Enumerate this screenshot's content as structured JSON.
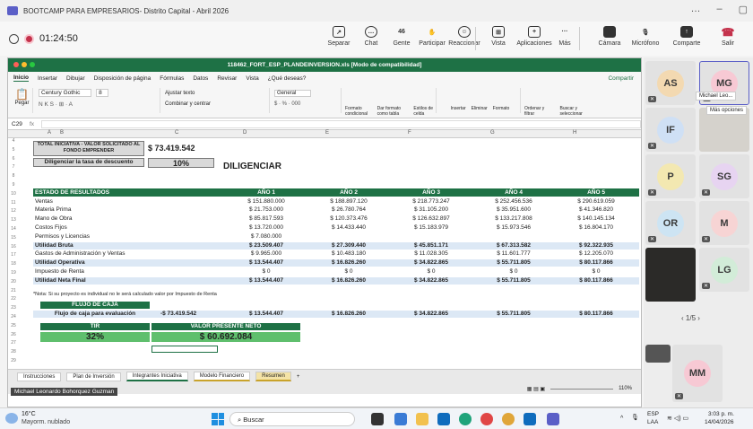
{
  "window": {
    "title": "BOOTCAMP PARA EMPRESARIOS- Distrito Capital - Abril 2026",
    "controls": [
      "…",
      "–",
      "▢"
    ]
  },
  "meeting": {
    "timer": "01:24:50",
    "buttons": {
      "separar": "Separar",
      "chat": "Chat",
      "gente": "Gente",
      "gente_count": "46",
      "participar": "Participar",
      "reaccionar": "Reaccionar",
      "vista": "Vista",
      "aplicaciones": "Aplicaciones",
      "mas": "Más",
      "camara": "Cámara",
      "microfono": "Micrófono",
      "comparte": "Comparte",
      "salir": "Salir"
    }
  },
  "excel": {
    "filename": "118462_FORT_ESP_PLANDEINVERSION.xls [Modo de compatibilidad]",
    "share": "Compartir",
    "menus": [
      "Inicio",
      "Insertar",
      "Dibujar",
      "Disposición de página",
      "Fórmulas",
      "Datos",
      "Revisar",
      "Vista",
      "¿Qué deseas?"
    ],
    "ribbon": {
      "paste": "Pegar",
      "font": "Century Gothic",
      "size": "8",
      "wrap": "Ajustar texto",
      "merge": "Combinar y centrar",
      "format": "General",
      "cond": "Formato condicional",
      "table": "Dar formato como tabla",
      "styles": "Estilos de celda",
      "insert": "Insertar",
      "delete": "Eliminar",
      "fmt": "Formato",
      "sort": "Ordenar y filtrar",
      "find": "Buscar y seleccionar"
    },
    "cellref": "C29",
    "fx": "fx",
    "columns": [
      "A",
      "B",
      "C",
      "D",
      "E",
      "F",
      "G",
      "H"
    ],
    "rows": [
      "4",
      "5",
      "6",
      "7",
      "8",
      "9",
      "10",
      "11",
      "12",
      "13",
      "14",
      "15",
      "16",
      "17",
      "18",
      "19",
      "20",
      "21",
      "22",
      "23",
      "24",
      "25",
      "26",
      "27",
      "28",
      "29"
    ],
    "total_label": "TOTAL INICIATIVA - VALOR SOLICITADO AL FONDO EMPRENDER",
    "total_value": "$ 73.419.542",
    "rate_label": "Diligenciar la tasa de descuento",
    "rate_value": "10%",
    "diligenciar": "DILIGENCIAR",
    "statement_header": [
      "ESTADO DE RESULTADOS",
      "AÑO 1",
      "AÑO 2",
      "AÑO 3",
      "AÑO 4",
      "AÑO 5"
    ],
    "statement": [
      {
        "label": "Ventas",
        "vals": [
          "$ 151.880.000",
          "$ 188.897.120",
          "$ 218.773.247",
          "$ 252.456.536",
          "$ 290.619.059"
        ],
        "bold": false
      },
      {
        "label": "Materia Prima",
        "vals": [
          "$ 21.753.000",
          "$ 26.780.764",
          "$ 31.105.200",
          "$ 35.951.600",
          "$ 41.346.820"
        ],
        "bold": false
      },
      {
        "label": "Mano de Obra",
        "vals": [
          "$ 85.817.593",
          "$ 120.373.476",
          "$ 126.632.897",
          "$ 133.217.808",
          "$ 140.145.134"
        ],
        "bold": false
      },
      {
        "label": "Costos Fijos",
        "vals": [
          "$ 13.720.000",
          "$ 14.433.440",
          "$ 15.183.979",
          "$ 15.973.546",
          "$ 16.804.170"
        ],
        "bold": false
      },
      {
        "label": "Permisos y Licencias",
        "vals": [
          "$ 7.080.000",
          "",
          "",
          "",
          ""
        ],
        "bold": false
      },
      {
        "label": "Utilidad Bruta",
        "vals": [
          "$ 23.509.407",
          "$ 27.309.440",
          "$ 45.851.171",
          "$ 67.313.582",
          "$ 92.322.935"
        ],
        "bold": true
      },
      {
        "label": "Gastos de Administración y Ventas",
        "vals": [
          "$ 9.965.000",
          "$ 10.483.180",
          "$ 11.028.305",
          "$ 11.601.777",
          "$ 12.205.070"
        ],
        "bold": false
      },
      {
        "label": "Utilidad Operativa",
        "vals": [
          "$ 13.544.407",
          "$ 16.826.260",
          "$ 34.822.865",
          "$ 55.711.805",
          "$ 80.117.866"
        ],
        "bold": true
      },
      {
        "label": "Impuesto de Renta",
        "vals": [
          "$ 0",
          "$ 0",
          "$ 0",
          "$ 0",
          "$ 0"
        ],
        "bold": false
      },
      {
        "label": "Utilidad Neta Final",
        "vals": [
          "$ 13.544.407",
          "$ 16.826.260",
          "$ 34.822.865",
          "$ 55.711.805",
          "$ 80.117.866"
        ],
        "bold": true
      }
    ],
    "note": "*Nota: Si su proyecto es individual no le será calculado valor por Impuesto de Renta",
    "cashflow_header": "FLUJO DE CAJA",
    "cashflow_label": "Flujo de caja para evaluación",
    "cashflow_vals": [
      "-$ 73.419.542",
      "$ 13.544.407",
      "$ 16.826.260",
      "$ 34.822.865",
      "$ 55.711.805",
      "$ 80.117.866"
    ],
    "tir_label": "TIR",
    "tir_value": "32%",
    "vpn_label": "VALOR PRESENTE NETO",
    "vpn_value": "$ 60.692.084",
    "tabs": [
      "Instrucciones",
      "Plan de Inversión",
      "Integrantes Iniciativa",
      "Modelo Financiero",
      "Resumen"
    ],
    "zoom": "110%"
  },
  "participants": {
    "tiles": [
      {
        "initials": "AS",
        "bg": "#f3d9b1"
      },
      {
        "initials": "MG",
        "bg": "#f7c9d4"
      },
      {
        "initials": "IF",
        "bg": "#cfe0f5"
      },
      {
        "initials": "P",
        "bg": "#f3e8b1"
      },
      {
        "initials": "SG",
        "bg": "#e7d4f1"
      },
      {
        "initials": "OR",
        "bg": "#cde4f3"
      },
      {
        "initials": "M",
        "bg": "#f7d4d4"
      },
      {
        "initials": "LG",
        "bg": "#d2ecd8"
      },
      {
        "initials": "MM",
        "bg": "#f7c9d4"
      }
    ],
    "tooltip_name": "Michael Leo...",
    "tooltip_more": "Más opciones",
    "page": "1/5",
    "speaker": "Michael Leonardo Bohorquez Guzman"
  },
  "taskbar": {
    "weather_temp": "16°C",
    "weather_desc": "Mayorm. nublado",
    "search": "Buscar",
    "lang": "ESP",
    "lang2": "LAA",
    "time": "3:03 p. m.",
    "date": "14/04/2026"
  }
}
